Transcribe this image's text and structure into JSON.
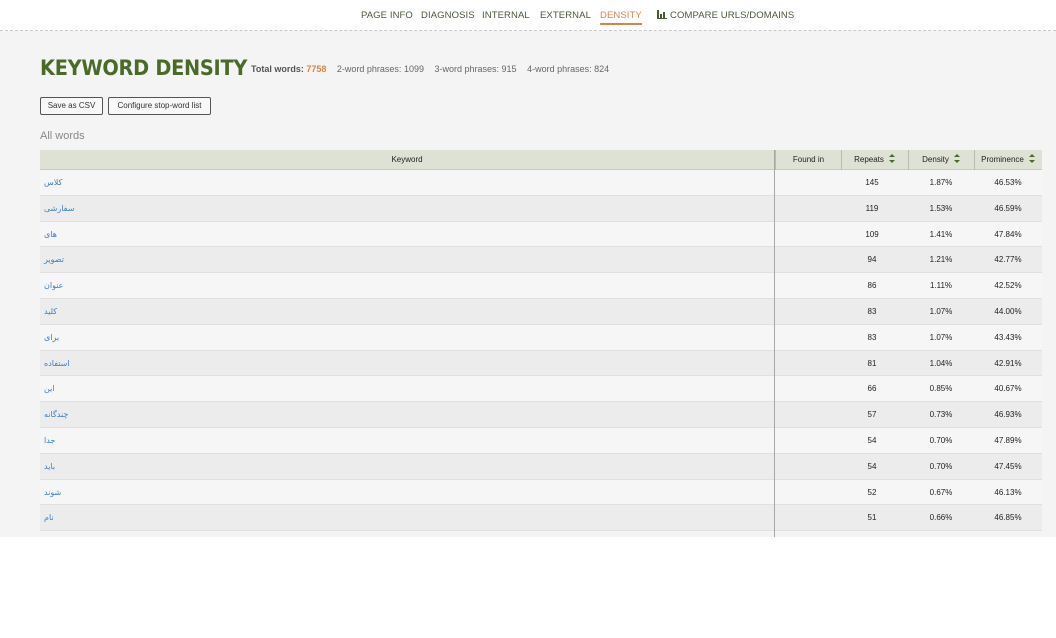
{
  "nav": {
    "items": [
      {
        "label": "PAGE INFO",
        "active": false
      },
      {
        "label": "DIAGNOSIS",
        "active": false
      },
      {
        "label": "INTERNAL",
        "active": false
      },
      {
        "label": "EXTERNAL",
        "active": false
      },
      {
        "label": "DENSITY",
        "active": true
      },
      {
        "label": "COMPARE URLS/DOMAINS",
        "active": false,
        "icon": "bar-chart-icon"
      }
    ]
  },
  "header": {
    "title": "KEYWORD DENSITY",
    "stats": {
      "total_words_label": "Total words:",
      "total_words_value": "7758",
      "two_word_label": "2-word phrases:",
      "two_word_value": "1099",
      "three_word_label": "3-word phrases:",
      "three_word_value": "915",
      "four_word_label": "4-word phrases:",
      "four_word_value": "824"
    }
  },
  "actions": {
    "save_csv": "Save as CSV",
    "configure_stopwords": "Configure stop-word list"
  },
  "section_label": "All words",
  "table": {
    "columns": {
      "keyword": "Keyword",
      "found_in": "Found in",
      "repeats": "Repeats",
      "density": "Density",
      "prominence": "Prominence"
    },
    "rows": [
      {
        "keyword": "کلاس",
        "found_in": "",
        "repeats": "145",
        "density": "1.87%",
        "prominence": "46.53%"
      },
      {
        "keyword": "سفارشی",
        "found_in": "",
        "repeats": "119",
        "density": "1.53%",
        "prominence": "46.59%"
      },
      {
        "keyword": "های",
        "found_in": "",
        "repeats": "109",
        "density": "1.41%",
        "prominence": "47.84%"
      },
      {
        "keyword": "تصویر",
        "found_in": "",
        "repeats": "94",
        "density": "1.21%",
        "prominence": "42.77%"
      },
      {
        "keyword": "عنوان",
        "found_in": "",
        "repeats": "86",
        "density": "1.11%",
        "prominence": "42.52%"
      },
      {
        "keyword": "کلید",
        "found_in": "",
        "repeats": "83",
        "density": "1.07%",
        "prominence": "44.00%"
      },
      {
        "keyword": "برای",
        "found_in": "",
        "repeats": "83",
        "density": "1.07%",
        "prominence": "43.43%"
      },
      {
        "keyword": "استفاده",
        "found_in": "",
        "repeats": "81",
        "density": "1.04%",
        "prominence": "42.91%"
      },
      {
        "keyword": "این",
        "found_in": "",
        "repeats": "66",
        "density": "0.85%",
        "prominence": "40.67%"
      },
      {
        "keyword": "چندگانه",
        "found_in": "",
        "repeats": "57",
        "density": "0.73%",
        "prominence": "46.93%"
      },
      {
        "keyword": "جدا",
        "found_in": "",
        "repeats": "54",
        "density": "0.70%",
        "prominence": "47.89%"
      },
      {
        "keyword": "باید",
        "found_in": "",
        "repeats": "54",
        "density": "0.70%",
        "prominence": "47.45%"
      },
      {
        "keyword": "شوند",
        "found_in": "",
        "repeats": "52",
        "density": "0.67%",
        "prominence": "46.13%"
      },
      {
        "keyword": "نام",
        "found_in": "",
        "repeats": "51",
        "density": "0.66%",
        "prominence": "46.85%"
      }
    ]
  }
}
